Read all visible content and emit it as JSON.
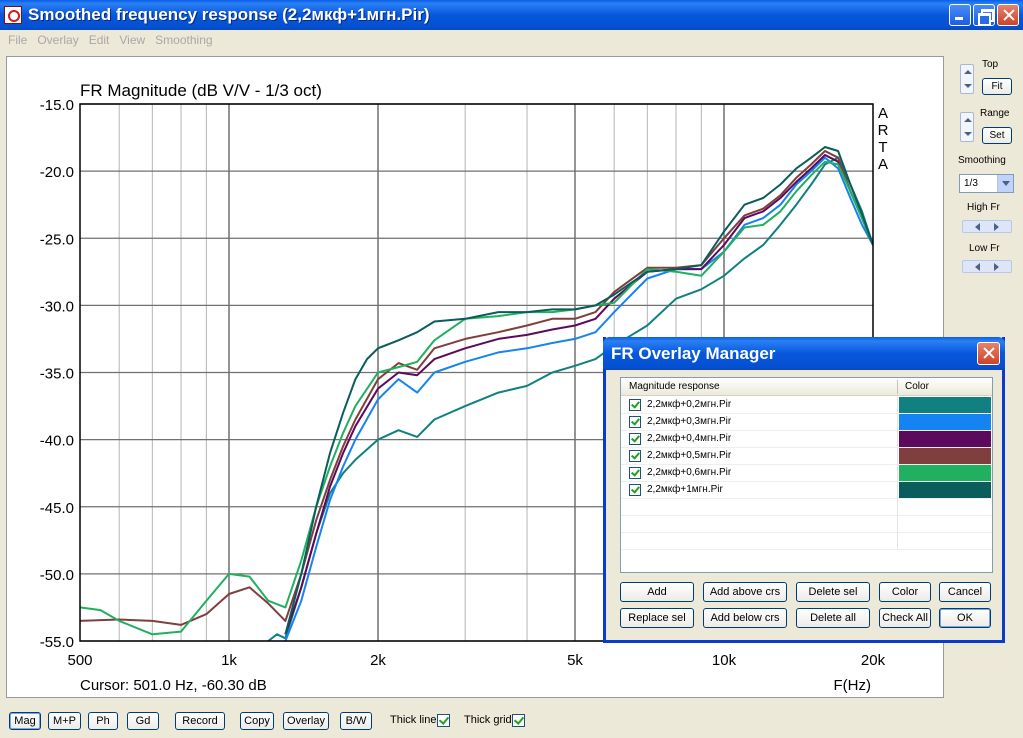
{
  "window": {
    "title": "Smoothed frequency response (2,2мкф+1мгн.Pir)"
  },
  "menu": [
    "File",
    "Overlay",
    "Edit",
    "View",
    "Smoothing"
  ],
  "side_panel": {
    "top_label": "Top",
    "fit_label": "Fit",
    "range_label": "Range",
    "set_label": "Set",
    "smoothing_label": "Smoothing",
    "smoothing_value": "1/3",
    "high_fr_label": "High Fr",
    "low_fr_label": "Low Fr"
  },
  "bottom_bar": {
    "buttons": [
      "Mag",
      "M+P",
      "Ph",
      "Gd",
      "Record",
      "Copy",
      "Overlay",
      "B/W"
    ],
    "thick_line_label": "Thick line",
    "thick_grid_label": "Thick grid"
  },
  "chart_data": {
    "type": "line",
    "title": "FR Magnitude (dB V/V - 1/3 oct)",
    "xlabel": "F(Hz)",
    "ylabel": "",
    "x_scale": "log",
    "xlim": [
      500,
      20000
    ],
    "ylim": [
      -55,
      -15
    ],
    "x_ticks": [
      "500",
      "1k",
      "2k",
      "5k",
      "10k",
      "20k"
    ],
    "x_tick_values": [
      500,
      1000,
      2000,
      5000,
      10000,
      20000
    ],
    "y_ticks": [
      "-15.0",
      "-20.0",
      "-25.0",
      "-30.0",
      "-35.0",
      "-40.0",
      "-45.0",
      "-50.0",
      "-55.0"
    ],
    "y_tick_values": [
      -15,
      -20,
      -25,
      -30,
      -35,
      -40,
      -45,
      -50,
      -55
    ],
    "watermark": "ARTA",
    "cursor_text": "Cursor: 501.0 Hz, -60.30 dB",
    "grid": true,
    "series": [
      {
        "name": "2,2мкф+0,2мгн.Pir",
        "color": "#108080",
        "x": [
          1200,
          1250,
          1300,
          1400,
          1500,
          1600,
          1700,
          1800,
          2000,
          2200,
          2400,
          2600,
          3000,
          3500,
          4000,
          4500,
          5000,
          5500,
          6000,
          7000,
          8000,
          9000,
          10000,
          11000,
          12000,
          13000,
          14000,
          15000,
          16000,
          17000,
          18000,
          19000,
          20000
        ],
        "y": [
          -55,
          -54.5,
          -54.8,
          -51,
          -47,
          -44,
          -42.5,
          -41.5,
          -40,
          -39.3,
          -39.8,
          -38.5,
          -37.5,
          -36.5,
          -36,
          -35,
          -34.5,
          -34,
          -33,
          -31.5,
          -29.5,
          -28.8,
          -27.8,
          -26.5,
          -25.5,
          -24,
          -22.5,
          -21,
          -19.5,
          -19,
          -21,
          -23,
          -25.5
        ]
      },
      {
        "name": "2,2мкф+0,3мгн.Pir",
        "color": "#1584F2",
        "x": [
          1300,
          1400,
          1500,
          1600,
          1700,
          1800,
          2000,
          2200,
          2400,
          2600,
          3000,
          3500,
          4000,
          4500,
          5000,
          5500,
          6000,
          7000,
          8000,
          9000,
          10000,
          11000,
          12000,
          13000,
          14000,
          15000,
          16000,
          17000,
          18000,
          19000,
          20000
        ],
        "y": [
          -55,
          -52,
          -48,
          -44.5,
          -42,
          -40,
          -37,
          -35.5,
          -36.5,
          -35,
          -34.2,
          -33.5,
          -33.2,
          -32.8,
          -32.5,
          -32,
          -30.5,
          -28,
          -27.3,
          -27.3,
          -26,
          -24,
          -23.5,
          -22.5,
          -21,
          -20,
          -19,
          -19.8,
          -22,
          -24,
          -25.5
        ]
      },
      {
        "name": "2,2мкф+0,4мгн.Pir",
        "color": "#5C0A5C",
        "x": [
          1300,
          1400,
          1500,
          1600,
          1700,
          1800,
          2000,
          2200,
          2400,
          2600,
          3000,
          3500,
          4000,
          4500,
          5000,
          5500,
          6000,
          7000,
          8000,
          9000,
          10000,
          11000,
          12000,
          13000,
          14000,
          15000,
          16000,
          17000,
          18000,
          19000,
          20000
        ],
        "y": [
          -54.5,
          -51,
          -47,
          -43.5,
          -41,
          -39,
          -36.2,
          -35,
          -35.2,
          -34,
          -33.2,
          -32.5,
          -32.2,
          -31.8,
          -31.5,
          -31,
          -29.5,
          -27.5,
          -27.3,
          -27.3,
          -25.5,
          -23.5,
          -23,
          -22,
          -20.8,
          -19.8,
          -18.8,
          -19.3,
          -21.5,
          -23.5,
          -25.5
        ]
      },
      {
        "name": "2,2мкф+0,5мгн.Pir",
        "color": "#7F3F3F",
        "x": [
          500,
          600,
          700,
          800,
          900,
          1000,
          1100,
          1200,
          1300,
          1400,
          1500,
          1600,
          1700,
          1800,
          2000,
          2200,
          2400,
          2600,
          3000,
          3500,
          4000,
          4500,
          5000,
          5500,
          6000,
          7000,
          8000,
          9000,
          10000,
          11000,
          12000,
          13000,
          14000,
          15000,
          16000,
          17000,
          18000,
          19000,
          20000
        ],
        "y": [
          -53.5,
          -53.4,
          -53.5,
          -53.8,
          -53,
          -51.5,
          -51,
          -52.2,
          -53.5,
          -50,
          -46,
          -43,
          -40.5,
          -38.5,
          -35.5,
          -34.3,
          -34.8,
          -33.2,
          -32.5,
          -32,
          -31.5,
          -31,
          -31,
          -30.5,
          -29,
          -27.2,
          -27.2,
          -27,
          -25,
          -23.3,
          -22.8,
          -21.8,
          -20.5,
          -19.5,
          -18.5,
          -19,
          -21.5,
          -23.5,
          -25.5
        ]
      },
      {
        "name": "2,2мкф+0,6мгн.Pir",
        "color": "#20B060",
        "x": [
          500,
          550,
          600,
          700,
          800,
          900,
          1000,
          1100,
          1200,
          1300,
          1400,
          1500,
          1600,
          1700,
          1800,
          2000,
          2200,
          2400,
          2600,
          3000,
          3500,
          4000,
          4500,
          5000,
          5500,
          6000,
          7000,
          8000,
          9000,
          10000,
          11000,
          12000,
          13000,
          14000,
          15000,
          16000,
          17000,
          18000,
          19000,
          20000
        ],
        "y": [
          -52.5,
          -52.7,
          -53.5,
          -54.5,
          -54.3,
          -52,
          -50,
          -50.2,
          -52,
          -52.5,
          -49,
          -45,
          -42,
          -39.5,
          -37.5,
          -35,
          -34.6,
          -34.2,
          -32.6,
          -31,
          -30.8,
          -30.5,
          -30.5,
          -30.3,
          -30,
          -29.8,
          -27.3,
          -27.5,
          -27.8,
          -26,
          -24.2,
          -24,
          -23,
          -21.5,
          -20.3,
          -19.3,
          -19.5,
          -21.5,
          -23.5,
          -25.5
        ]
      },
      {
        "name": "2,2мкф+1мгн.Pir",
        "color": "#0B5C5C",
        "x": [
          1300,
          1400,
          1500,
          1600,
          1700,
          1800,
          1900,
          2000,
          2200,
          2400,
          2600,
          3000,
          3500,
          4000,
          4500,
          5000,
          5500,
          6000,
          7000,
          8000,
          9000,
          10000,
          11000,
          12000,
          13000,
          14000,
          15000,
          16000,
          17000,
          18000,
          19000,
          20000
        ],
        "y": [
          -54.5,
          -50,
          -45,
          -41,
          -38,
          -35.5,
          -34,
          -33.2,
          -32.6,
          -32,
          -31.2,
          -31,
          -30.5,
          -30.5,
          -30.3,
          -30.3,
          -30,
          -29.2,
          -27.5,
          -27.3,
          -27,
          -24.5,
          -22.5,
          -22,
          -21,
          -19.8,
          -19,
          -18.2,
          -18.5,
          -21,
          -23.2,
          -25.5
        ]
      }
    ]
  },
  "overlay_manager": {
    "title": "FR Overlay Manager",
    "col_name": "Magnitude response",
    "col_color": "Color",
    "buttons_row1": [
      "Add",
      "Add above crs",
      "Delete sel",
      "Color",
      "Cancel"
    ],
    "buttons_row2": [
      "Replace sel",
      "Add below crs",
      "Delete all",
      "Check All",
      "OK"
    ]
  }
}
